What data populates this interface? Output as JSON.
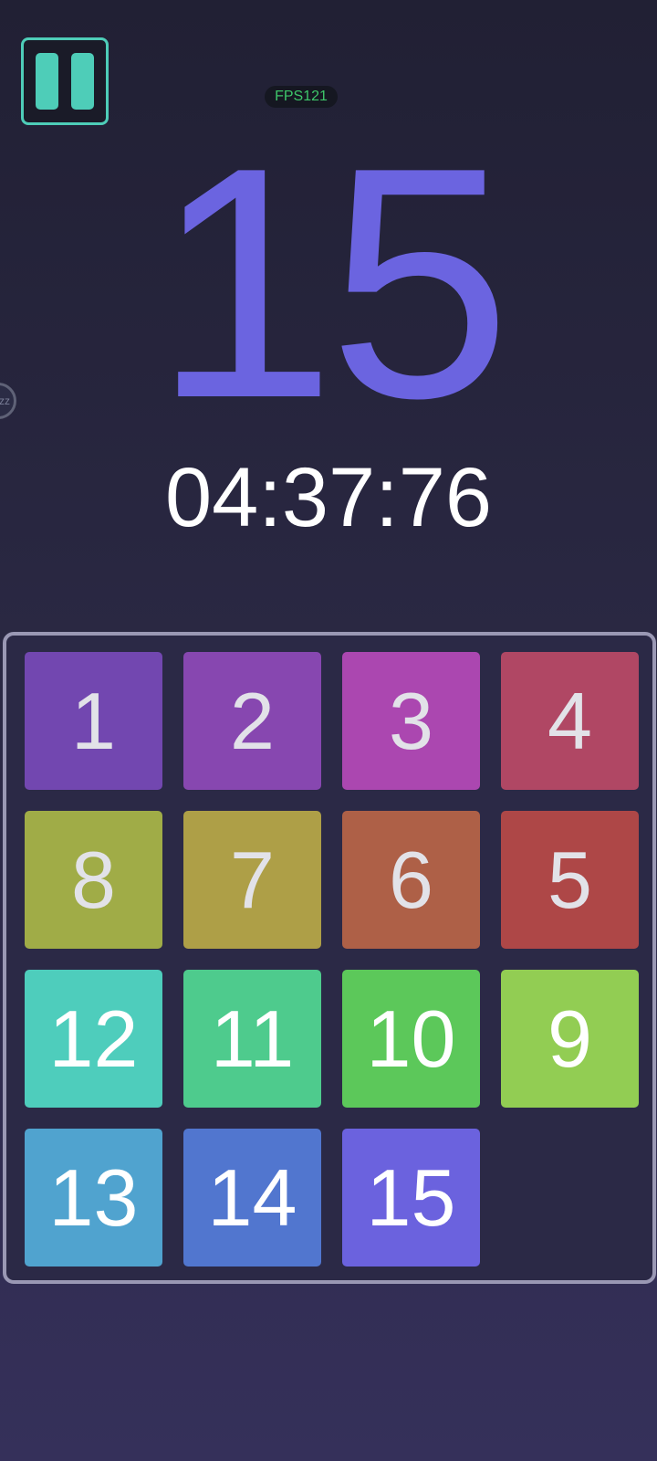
{
  "hud": {
    "fps_label": "FPS121",
    "side_bubble_text": "zz"
  },
  "score": {
    "moves": "15",
    "time": "04:37:76"
  },
  "board": {
    "tiles": [
      {
        "label": "1",
        "color": "#7247b0"
      },
      {
        "label": "2",
        "color": "#8747b0"
      },
      {
        "label": "3",
        "color": "#ab47b0"
      },
      {
        "label": "4",
        "color": "#b04764"
      },
      {
        "label": "8",
        "color": "#a0ac47"
      },
      {
        "label": "7",
        "color": "#ae9f47"
      },
      {
        "label": "6",
        "color": "#ae6047"
      },
      {
        "label": "5",
        "color": "#ae4747"
      },
      {
        "label": "12",
        "color": "#4ecdbc"
      },
      {
        "label": "11",
        "color": "#4ecb8d"
      },
      {
        "label": "10",
        "color": "#5cc85a"
      },
      {
        "label": "9",
        "color": "#92cd53"
      },
      {
        "label": "13",
        "color": "#50a3cf"
      },
      {
        "label": "14",
        "color": "#5176cf"
      },
      {
        "label": "15",
        "color": "#6b62de"
      }
    ]
  },
  "colors": {
    "accent": "#4ecdb8",
    "move_count": "#6b64e0",
    "fps": "#3ec66a"
  }
}
